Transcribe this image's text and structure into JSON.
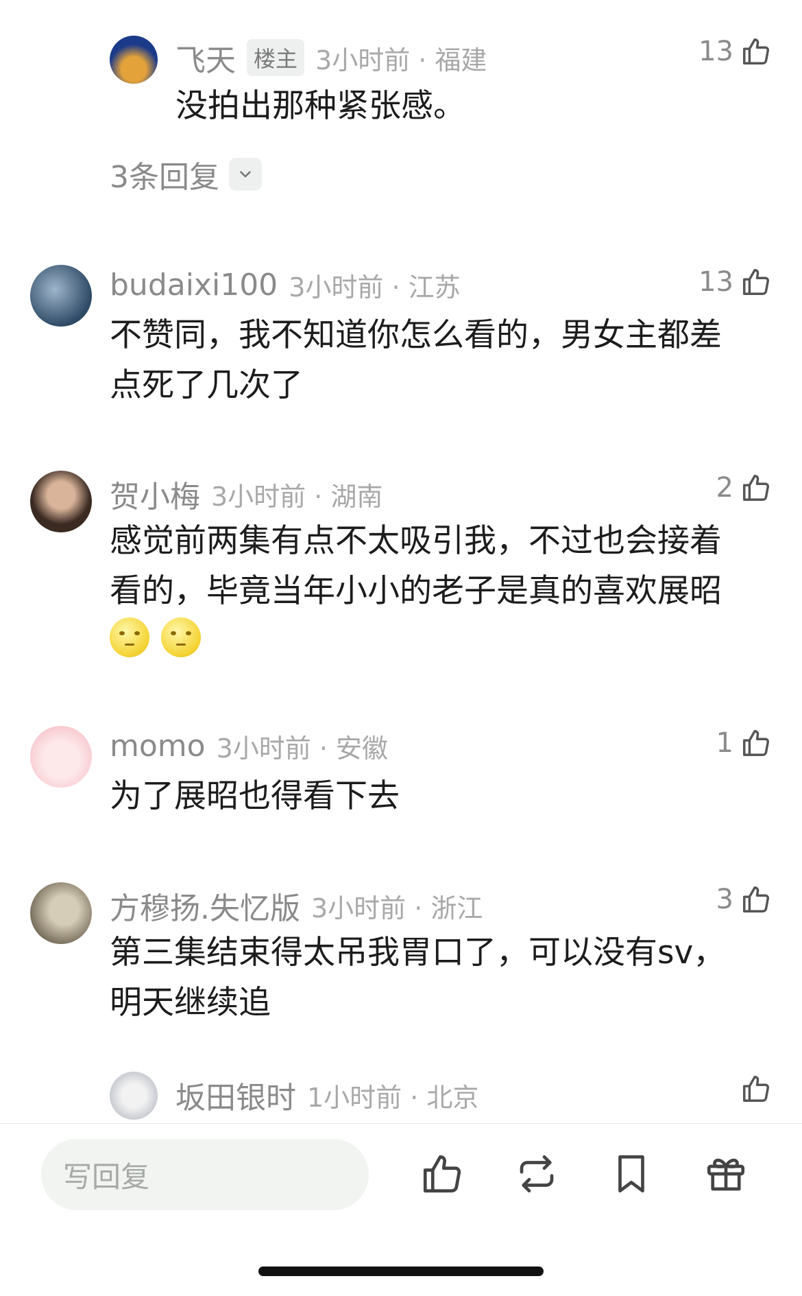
{
  "comments": [
    {
      "user": "飞天",
      "badge": "楼主",
      "time": "3小时前 · 福建",
      "likes": "13",
      "text": "没拍出那种紧张感。",
      "replies": "3条回复",
      "avatar_colors": [
        "#1c3a8a",
        "#e3a23a"
      ]
    },
    {
      "user": "budaixi100",
      "time": "3小时前 · 江苏",
      "likes": "13",
      "text": "不赞同，我不知道你怎么看的，男女主都差\n点死了几次了",
      "avatar_colors": [
        "#2e4a66",
        "#9fb6cc"
      ]
    },
    {
      "user": "贺小梅",
      "time": "3小时前 · 湖南",
      "likes": "2",
      "text": "感觉前两集有点不太吸引我，不过也会接着\n看的，毕竟当年小小的老子是真的喜欢展昭",
      "emojis": [
        "moon-face",
        "moon-face"
      ],
      "avatar_colors": [
        "#3b2a22",
        "#d9b49a"
      ]
    },
    {
      "user": "momo",
      "time": "3小时前 · 安徽",
      "likes": "1",
      "text": "为了展昭也得看下去",
      "avatar_colors": [
        "#f7c9cf",
        "#fde8ea"
      ]
    },
    {
      "user": "方穆扬.失忆版",
      "time": "3小时前 · 浙江",
      "likes": "3",
      "text": "第三集结束得太吊我胃口了，可以没有sv，\n明天继续追",
      "avatar_colors": [
        "#7c7260",
        "#d6cdb8"
      ]
    },
    {
      "user": "坂田银时",
      "time": "1小时前 · 北京",
      "likes": "",
      "text": "",
      "avatar_colors": [
        "#c9ccd2",
        "#f2f2f2"
      ]
    }
  ],
  "bottom_bar": {
    "reply_placeholder": "写回复",
    "icons": [
      "thumbs-up-icon",
      "repost-icon",
      "bookmark-icon",
      "gift-icon"
    ]
  }
}
